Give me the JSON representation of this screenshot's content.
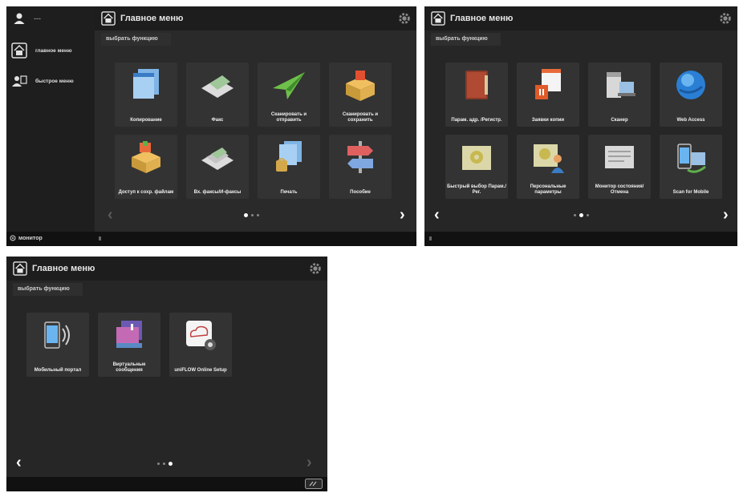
{
  "screens": {
    "s1": {
      "title": "Главное меню",
      "subtitle": "выбрать функцию",
      "user": {
        "name": "---"
      },
      "sidebar": {
        "items": [
          {
            "label": "главное меню"
          },
          {
            "label": "быстрое меню"
          }
        ]
      },
      "tiles": [
        {
          "label": "Копирование",
          "icon": "copy-icon"
        },
        {
          "label": "Факс",
          "icon": "fax-icon"
        },
        {
          "label": "Сканировать и отправить",
          "icon": "scan-send-icon"
        },
        {
          "label": "Сканировать и сохранить",
          "icon": "scan-store-icon"
        },
        {
          "label": "Доступ к сохр. файлам",
          "icon": "stored-files-icon"
        },
        {
          "label": "Вх. факсы/И-факсы",
          "icon": "fax-inbox-icon"
        },
        {
          "label": "Печать",
          "icon": "print-icon"
        },
        {
          "label": "Пособие",
          "icon": "tutorial-icon"
        }
      ],
      "pagination": {
        "current": 1,
        "total": 3
      },
      "status": {
        "monitor_label": "монитор"
      }
    },
    "s2": {
      "title": "Главное меню",
      "subtitle": "выбрать функцию",
      "tiles": [
        {
          "label": "Парам. адр. /Регистр.",
          "icon": "address-book-icon"
        },
        {
          "label": "Заявки копии",
          "icon": "copy-card-icon"
        },
        {
          "label": "Сканер",
          "icon": "scanner-icon"
        },
        {
          "label": "Web Access",
          "icon": "web-globe-icon"
        },
        {
          "label": "Быстрый выбор Парам./Рег.",
          "icon": "quick-settings-icon"
        },
        {
          "label": "Персональные параметры",
          "icon": "personal-settings-icon"
        },
        {
          "label": "Монитор состояния/Отмена",
          "icon": "status-monitor-icon"
        },
        {
          "label": "Scan for Mobile",
          "icon": "scan-mobile-icon"
        }
      ],
      "pagination": {
        "current": 2,
        "total": 3
      }
    },
    "s3": {
      "title": "Главное меню",
      "subtitle": "выбрать функцию",
      "tiles": [
        {
          "label": "Мобильный портал",
          "icon": "mobile-portal-icon"
        },
        {
          "label": "Виртуальные сообщения",
          "icon": "messages-icon"
        },
        {
          "label": "uniFLOW Online Setup",
          "icon": "cloud-setup-icon"
        }
      ],
      "pagination": {
        "current": 3,
        "total": 3
      }
    }
  },
  "colors": {
    "screen_bg": "#262626",
    "topbar_bg": "#1d1d1d",
    "tile_bg": "#333333"
  }
}
